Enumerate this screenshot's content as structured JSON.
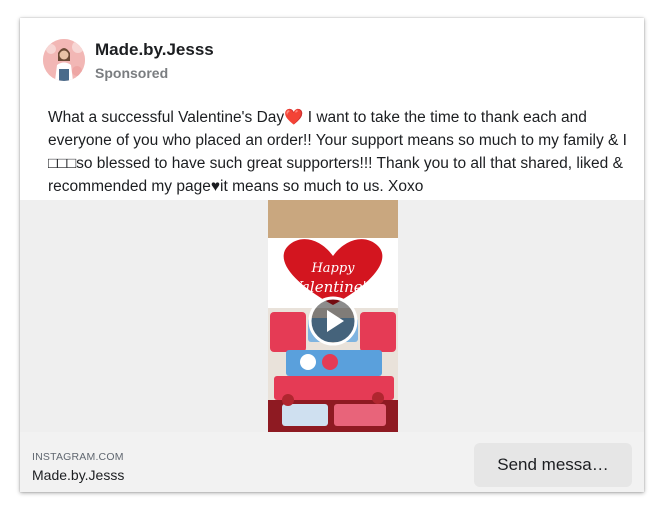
{
  "post": {
    "page_name": "Made.by.Jesss",
    "sponsored_label": "Sponsored",
    "text": "What a successful Valentine's Day❤️ I want to take the time to thank each and everyone of you who placed an order!! Your support means so much to my family & I □□□so blessed to have such great supporters!!! Thank you to all that shared, liked & recommended my page♥it means so much to us. Xoxo"
  },
  "media": {
    "thumbnail_caption": "Happy Valentine's",
    "play_icon": "play-icon"
  },
  "footer": {
    "source_domain": "INSTAGRAM.COM",
    "source_name": "Made.by.Jesss",
    "cta_label": "Send messa…"
  },
  "colors": {
    "card_background": "#ffffff",
    "media_background": "#efefef",
    "footer_background": "#f2f2f2",
    "button_background": "#e6e6e6",
    "heart_red": "#d3151f"
  }
}
